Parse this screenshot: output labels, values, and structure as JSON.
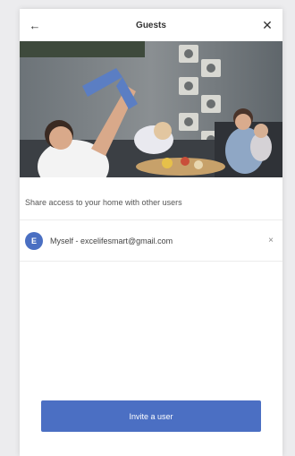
{
  "header": {
    "title": "Guests",
    "back_icon": "←",
    "close_icon": "✕"
  },
  "subtitle": "Share access to your home with other users",
  "guests": [
    {
      "avatar_letter": "E",
      "label": "Myself - excelifesmart@gmail.com",
      "remove_icon": "×"
    }
  ],
  "invite_label": "Invite a user",
  "colors": {
    "accent": "#4b6fc3",
    "background": "#ffffff"
  }
}
